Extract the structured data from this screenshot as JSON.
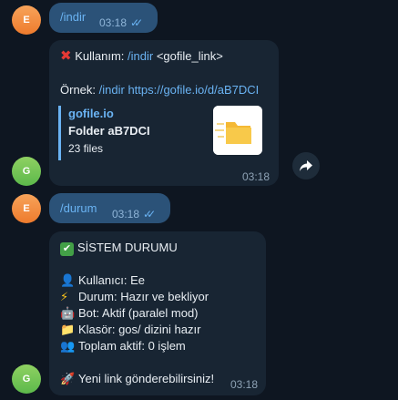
{
  "messages": {
    "m1": {
      "avatar": "E",
      "text": "/indir",
      "time": "03:18"
    },
    "m2": {
      "avatar": "G",
      "usage_prefix": "Kullanım: ",
      "usage_cmd": "/indir",
      "usage_arg": " <gofile_link>",
      "example_prefix": "Örnek: ",
      "example_cmd": "/indir",
      "example_link": "https://gofile.io/d/aB7DCI",
      "preview": {
        "site": "gofile.io",
        "title": "Folder aB7DCI",
        "sub": "23 files"
      },
      "time": "03:18"
    },
    "m3": {
      "avatar": "E",
      "text": "/durum",
      "time": "03:18"
    },
    "m4": {
      "avatar": "G",
      "title": "SİSTEM DURUMU",
      "lines": [
        "Kullanıcı: Ee",
        "Durum: Hazır ve bekliyor",
        "Bot: Aktif (paralel mod)",
        "Klasör: gos/ dizini hazır",
        "Toplam aktif: 0 işlem"
      ],
      "footer": "Yeni link gönderebilirsiniz!",
      "time": "03:18"
    }
  },
  "icons": {
    "cross": "cross-mark-icon",
    "check": "check-mark-icon",
    "share": "share-icon",
    "read": "double-check-icon"
  },
  "colors": {
    "background": "#0e1621",
    "outgoing": "#2b5278",
    "incoming": "#182533",
    "link": "#6ab3f3"
  }
}
